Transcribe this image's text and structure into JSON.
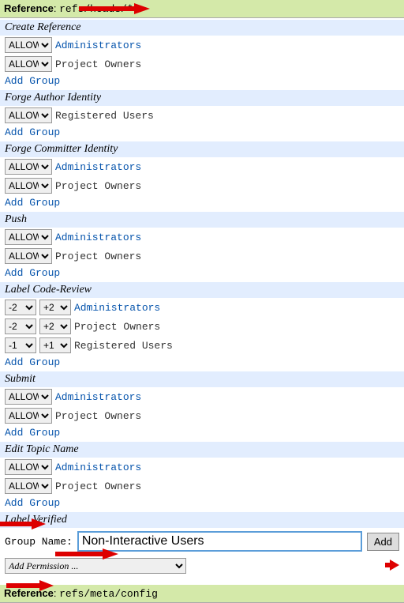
{
  "ref1": {
    "label": "Reference",
    "value": "refs/heads/*"
  },
  "ref2": {
    "label": "Reference",
    "value": "refs/meta/config"
  },
  "allow": "ALLOW",
  "addGroup": "Add Group",
  "sections": {
    "createRef": {
      "title": "Create Reference",
      "rows": [
        {
          "group": "Administrators",
          "link": true
        },
        {
          "group": "Project Owners",
          "link": false
        }
      ]
    },
    "forgeAuthor": {
      "title": "Forge Author Identity",
      "rows": [
        {
          "group": "Registered Users",
          "link": false
        }
      ]
    },
    "forgeCommitter": {
      "title": "Forge Committer Identity",
      "rows": [
        {
          "group": "Administrators",
          "link": true
        },
        {
          "group": "Project Owners",
          "link": false
        }
      ]
    },
    "push": {
      "title": "Push",
      "rows": [
        {
          "group": "Administrators",
          "link": true
        },
        {
          "group": "Project Owners",
          "link": false
        }
      ]
    },
    "labelCodeReview": {
      "title": "Label Code-Review",
      "rows": [
        {
          "min": "-2",
          "max": "+2",
          "group": "Administrators",
          "link": true
        },
        {
          "min": "-2",
          "max": "+2",
          "group": "Project Owners",
          "link": false
        },
        {
          "min": "-1",
          "max": "+1",
          "group": "Registered Users",
          "link": false
        }
      ]
    },
    "submit": {
      "title": "Submit",
      "rows": [
        {
          "group": "Administrators",
          "link": true
        },
        {
          "group": "Project Owners",
          "link": false
        }
      ]
    },
    "editTopic": {
      "title": "Edit Topic Name",
      "rows": [
        {
          "group": "Administrators",
          "link": true
        },
        {
          "group": "Project Owners",
          "link": false
        }
      ]
    },
    "labelVerified": {
      "title": "Label Verified"
    }
  },
  "groupName": {
    "label": "Group Name:",
    "value": "Non-Interactive Users",
    "button": "Add"
  },
  "addPermission": "Add Permission ..."
}
